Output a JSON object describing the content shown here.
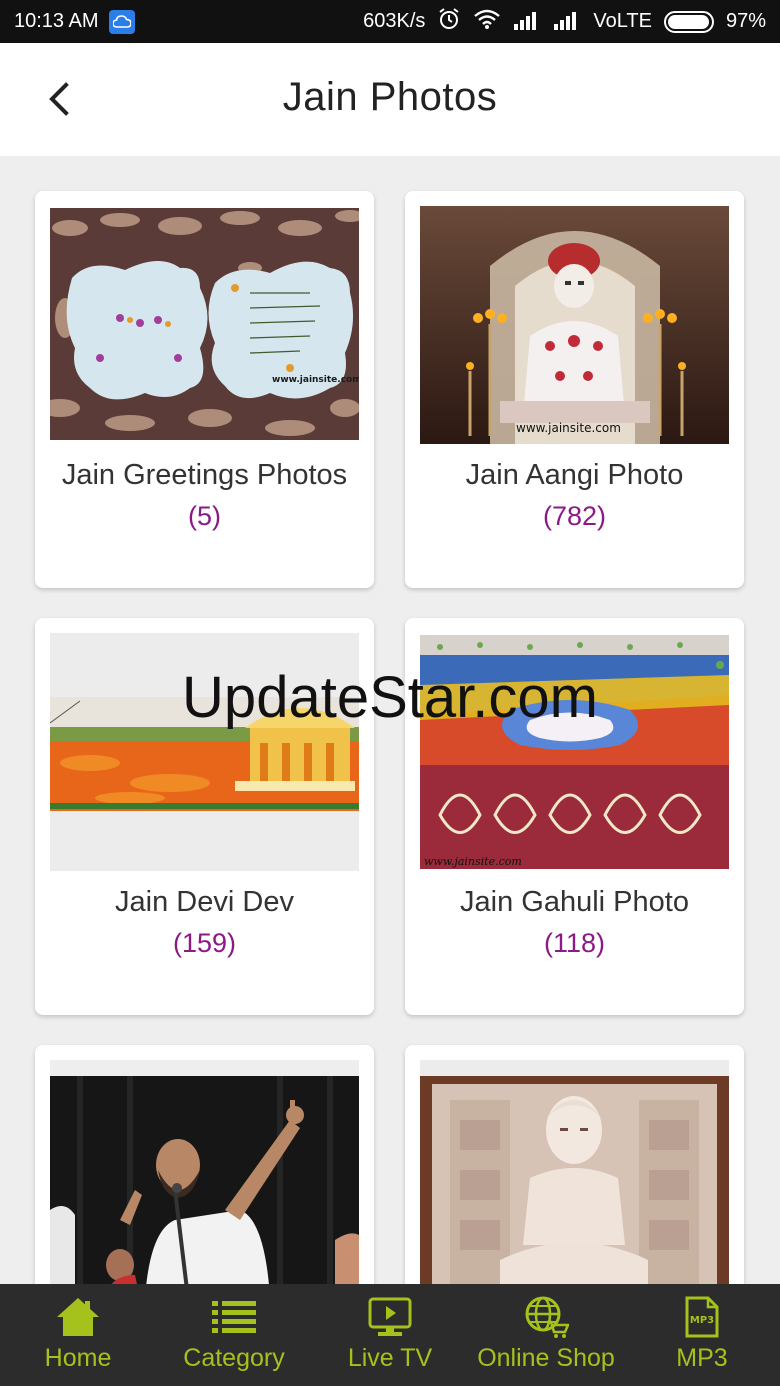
{
  "status_bar": {
    "time": "10:13 AM",
    "speed": "603K/s",
    "network": "VoLTE",
    "battery_percent": "97%",
    "battery_level": 0.97
  },
  "header": {
    "title": "Jain Photos"
  },
  "watermark": "UpdateStar.com",
  "categories": [
    {
      "name": "Jain Greetings Photos",
      "count": "(5)"
    },
    {
      "name": "Jain Aangi Photo",
      "count": "(782)"
    },
    {
      "name": "Jain Devi Dev",
      "count": "(159)"
    },
    {
      "name": "Jain Gahuli Photo",
      "count": "(118)"
    },
    {
      "name": "",
      "count": ""
    },
    {
      "name": "",
      "count": ""
    }
  ],
  "thumb_watermarks": {
    "greetings": "www.jainsite.com",
    "aangi": "www.jainsite.com",
    "gahuli": "www.jainsite.com"
  },
  "bottom_nav": {
    "items": [
      {
        "label": "Home",
        "icon": "home-icon"
      },
      {
        "label": "Category",
        "icon": "list-icon"
      },
      {
        "label": "Live TV",
        "icon": "tv-play-icon"
      },
      {
        "label": "Online Shop",
        "icon": "globe-cart-icon"
      },
      {
        "label": "MP3",
        "icon": "mp3-file-icon"
      }
    ],
    "mp3_badge": "MP3",
    "accent_color": "#a4c21b",
    "background_color": "#2c2c2c"
  },
  "colors": {
    "count_text": "#8b1a86",
    "page_background": "#eeeeee"
  }
}
